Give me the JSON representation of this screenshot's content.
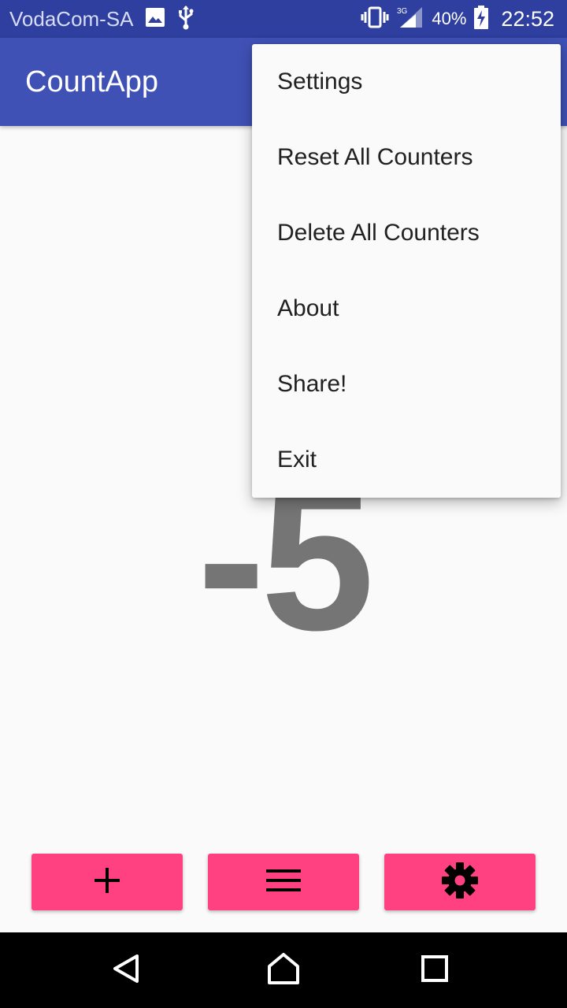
{
  "status_bar": {
    "carrier": "VodaCom-SA",
    "icons": [
      "image-icon",
      "usb-icon",
      "vibrate-icon",
      "signal-3g-icon",
      "battery-charging-icon"
    ],
    "network": "3G",
    "battery": "40%",
    "time": "22:52"
  },
  "app_bar": {
    "title": "CountApp"
  },
  "counter": {
    "value": "-5"
  },
  "overflow_menu": {
    "items": [
      "Settings",
      "Reset All Counters",
      "Delete All Counters",
      "About",
      "Share!",
      "Exit"
    ]
  },
  "bottom_buttons": [
    {
      "icon": "plus-icon"
    },
    {
      "icon": "menu-icon"
    },
    {
      "icon": "gear-icon"
    }
  ],
  "nav_bar": {
    "icons": [
      "back-icon",
      "home-icon",
      "recents-icon"
    ]
  },
  "colors": {
    "status_bar": "#2f3f9f",
    "primary": "#3f51b5",
    "accent": "#ff4081",
    "counter_text": "#757575",
    "background": "#fafafa"
  }
}
